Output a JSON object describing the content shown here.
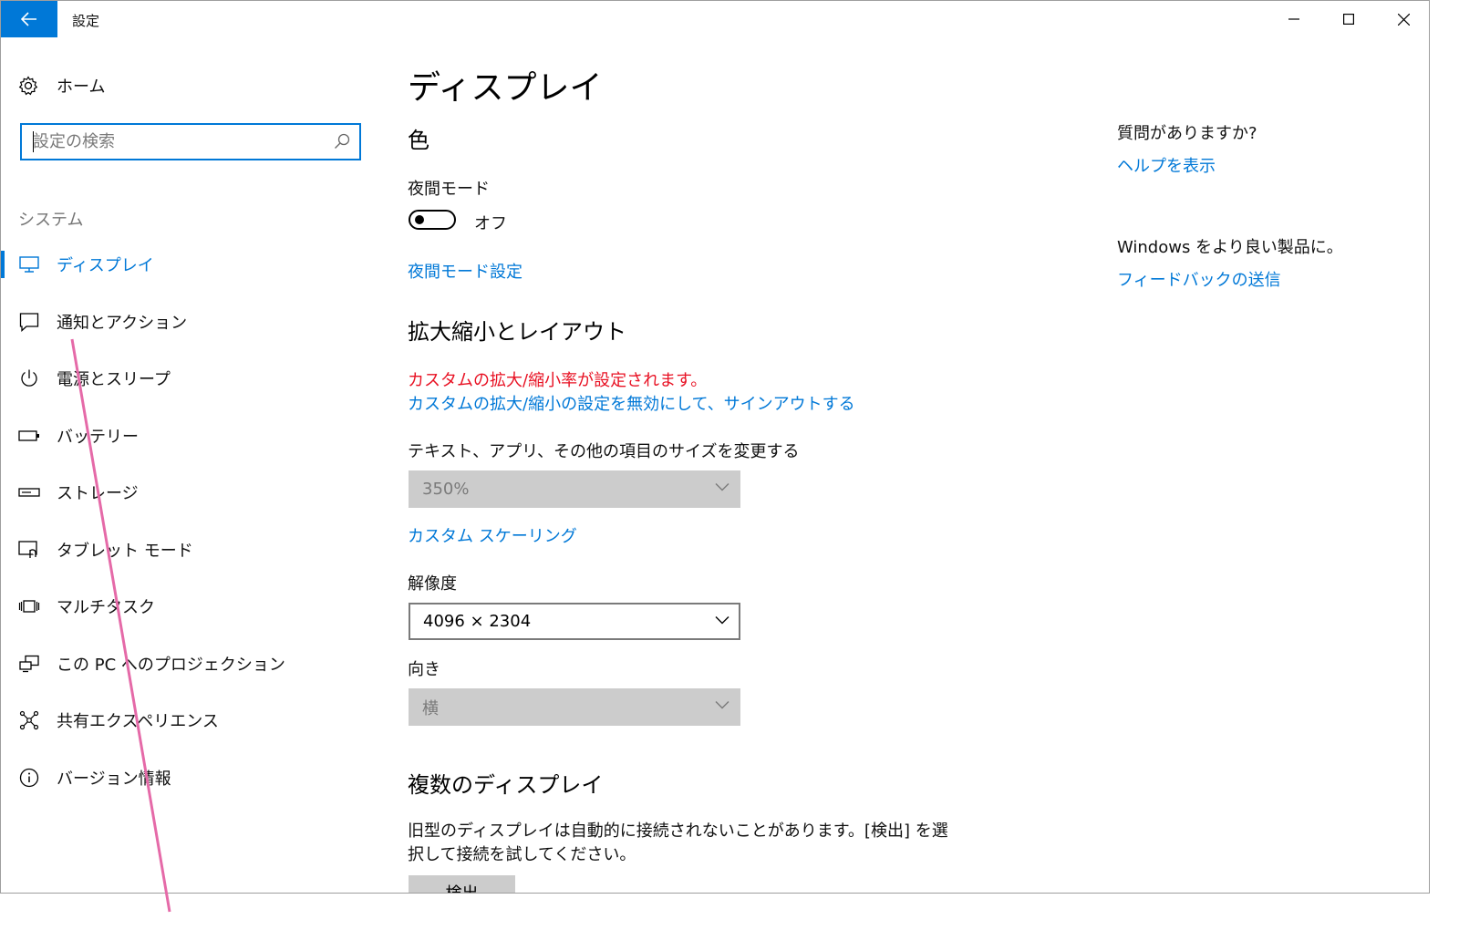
{
  "window": {
    "title": "設定"
  },
  "sidebar": {
    "home_label": "ホーム",
    "search_placeholder": "設定の検索",
    "section_label": "システム",
    "items": [
      {
        "label": "ディスプレイ",
        "icon": "monitor-icon",
        "active": true
      },
      {
        "label": "通知とアクション",
        "icon": "notification-icon",
        "active": false
      },
      {
        "label": "電源とスリープ",
        "icon": "power-icon",
        "active": false
      },
      {
        "label": "バッテリー",
        "icon": "battery-icon",
        "active": false
      },
      {
        "label": "ストレージ",
        "icon": "storage-icon",
        "active": false
      },
      {
        "label": "タブレット モード",
        "icon": "tablet-mode-icon",
        "active": false
      },
      {
        "label": "マルチタスク",
        "icon": "multitask-icon",
        "active": false
      },
      {
        "label": "この PC へのプロジェクション",
        "icon": "projection-icon",
        "active": false
      },
      {
        "label": "共有エクスペリエンス",
        "icon": "shared-experience-icon",
        "active": false
      },
      {
        "label": "バージョン情報",
        "icon": "info-icon",
        "active": false
      }
    ]
  },
  "main": {
    "page_title": "ディスプレイ",
    "color_section": {
      "heading": "色",
      "night_mode_label": "夜間モード",
      "toggle_state": "オフ",
      "night_mode_settings_link": "夜間モード設定"
    },
    "scale_section": {
      "heading": "拡大縮小とレイアウト",
      "custom_scale_warning": "カスタムの拡大/縮小率が設定されます。",
      "disable_custom_link": "カスタムの拡大/縮小の設定を無効にして、サインアウトする",
      "size_label": "テキスト、アプリ、その他の項目のサイズを変更する",
      "size_value": "350%",
      "custom_scaling_link": "カスタム スケーリング",
      "resolution_label": "解像度",
      "resolution_value": "4096 × 2304",
      "orientation_label": "向き",
      "orientation_value": "横"
    },
    "multi_display_section": {
      "heading": "複数のディスプレイ",
      "description": "旧型のディスプレイは自動的に接続されないことがあります。[検出] を選択して接続を試してください。",
      "detect_button": "検出"
    }
  },
  "aside": {
    "question_heading": "質問がありますか?",
    "help_link": "ヘルプを表示",
    "feedback_heading": "Windows をより良い製品に。",
    "feedback_link": "フィードバックの送信"
  },
  "colors": {
    "accent": "#0078d7",
    "error": "#e81123",
    "disabled_fill": "#cccccc",
    "annotation_line": "#e56aa8"
  }
}
